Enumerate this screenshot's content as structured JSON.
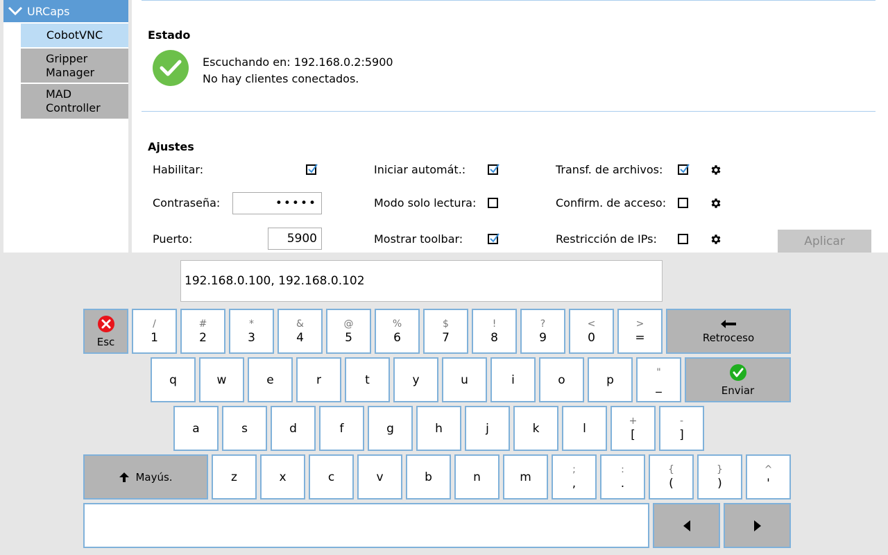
{
  "sidebar": {
    "header": "URCaps",
    "items": [
      "CobotVNC",
      "Gripper\nManager",
      "MAD\nController"
    ]
  },
  "status": {
    "title": "Estado",
    "line1": "Escuchando en: 192.168.0.2:5900",
    "line2": "No hay clientes conectados."
  },
  "settings": {
    "title": "Ajustes",
    "habilitar": {
      "label": "Habilitar:",
      "checked": true
    },
    "password": {
      "label": "Contraseña:",
      "value": "•••••"
    },
    "port": {
      "label": "Puerto:",
      "value": "5900"
    },
    "autostart": {
      "label": "Iniciar automát.:",
      "checked": true
    },
    "readonly": {
      "label": "Modo solo lectura:",
      "checked": false
    },
    "toolbar": {
      "label": "Mostrar toolbar:",
      "checked": true
    },
    "filetransfer": {
      "label": "Transf. de archivos:",
      "checked": true
    },
    "confirm": {
      "label": "Confirm. de acceso:",
      "checked": false
    },
    "iprestrict": {
      "label": "Restricción de IPs:",
      "checked": false
    },
    "apply_label": "Aplicar"
  },
  "keyboard": {
    "input_value": "192.168.0.100, 192.168.0.102",
    "esc_label": "Esc",
    "backspace_label": "Retroceso",
    "enter_label": "Enviar",
    "shift_label": "Mayús.",
    "row1": [
      [
        "/",
        "1"
      ],
      [
        "#",
        "2"
      ],
      [
        "*",
        "3"
      ],
      [
        "&",
        "4"
      ],
      [
        "@",
        "5"
      ],
      [
        "%",
        "6"
      ],
      [
        "$",
        "7"
      ],
      [
        "!",
        "8"
      ],
      [
        "?",
        "9"
      ],
      [
        "<",
        "0"
      ],
      [
        ">",
        "="
      ]
    ],
    "row2": [
      [
        "",
        "q"
      ],
      [
        "",
        "w"
      ],
      [
        "",
        "e"
      ],
      [
        "",
        "r"
      ],
      [
        "",
        "t"
      ],
      [
        "",
        "y"
      ],
      [
        "",
        "u"
      ],
      [
        "",
        "i"
      ],
      [
        "",
        "o"
      ],
      [
        "",
        "p"
      ],
      [
        "\"",
        "_"
      ]
    ],
    "row3": [
      [
        "",
        "a"
      ],
      [
        "",
        "s"
      ],
      [
        "",
        "d"
      ],
      [
        "",
        "f"
      ],
      [
        "",
        "g"
      ],
      [
        "",
        "h"
      ],
      [
        "",
        "j"
      ],
      [
        "",
        "k"
      ],
      [
        "",
        "l"
      ],
      [
        "+",
        "["
      ],
      [
        "-",
        "]"
      ]
    ],
    "row4": [
      [
        "",
        "z"
      ],
      [
        "",
        "x"
      ],
      [
        "",
        "c"
      ],
      [
        "",
        "v"
      ],
      [
        "",
        "b"
      ],
      [
        "",
        "n"
      ],
      [
        "",
        "m"
      ],
      [
        ";",
        ","
      ],
      [
        ":",
        "."
      ],
      [
        "{",
        "("
      ],
      [
        "}",
        ")"
      ],
      [
        "^",
        "'"
      ]
    ]
  }
}
